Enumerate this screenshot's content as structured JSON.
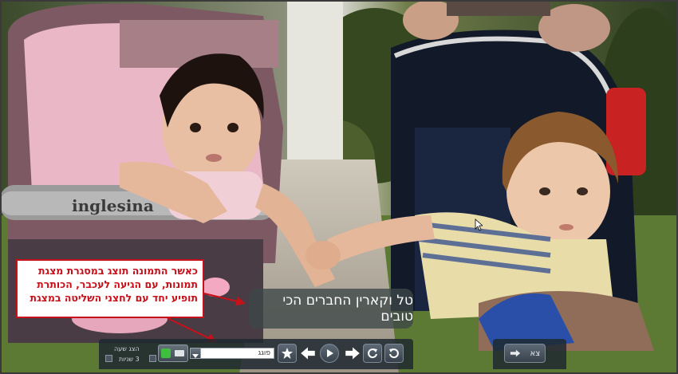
{
  "slideshow": {
    "caption": "טל וקארין החברים הכי טובים",
    "callout_text": "כאשר התמונה תוצג במסגרת מצגת תמונות, עם הגיעה לעכבר, הכותרת תופיע יחד עם לחצני השליטה במצגת",
    "stroller_brand": "inglesina",
    "toolbar": {
      "speed_label": "הצג שעה",
      "speed_value": "3 שניות",
      "effect_value": "פוגג",
      "exit_label": "צא"
    },
    "icons": {
      "favorite": "star-icon",
      "prev": "arrow-left-icon",
      "play": "play-icon",
      "next": "arrow-right-icon",
      "rotate_right": "rotate-clockwise-icon",
      "rotate_left": "rotate-counterclockwise-icon",
      "exit": "exit-arrow-icon"
    },
    "accent_color": "#c8101a"
  }
}
